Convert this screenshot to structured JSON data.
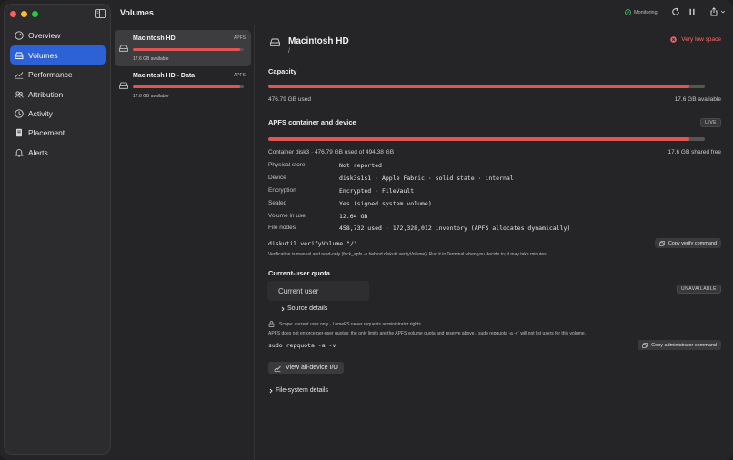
{
  "toolbar": {
    "title": "Volumes",
    "monitoring": "Monitoring"
  },
  "sidebar": {
    "items": [
      {
        "label": "Overview",
        "icon": "dashboard-icon"
      },
      {
        "label": "Volumes",
        "icon": "drive-icon"
      },
      {
        "label": "Performance",
        "icon": "chart-line-icon"
      },
      {
        "label": "Attribution",
        "icon": "people-icon"
      },
      {
        "label": "Activity",
        "icon": "clock-icon"
      },
      {
        "label": "Placement",
        "icon": "document-icon"
      },
      {
        "label": "Alerts",
        "icon": "bell-icon"
      }
    ],
    "active_index": 1
  },
  "volumes": [
    {
      "name": "Macintosh HD",
      "fs": "APFS",
      "available": "17.6 GB available",
      "used_fraction": 0.965
    },
    {
      "name": "Macintosh HD - Data",
      "fs": "APFS",
      "available": "17.6 GB available",
      "used_fraction": 0.965
    }
  ],
  "detail": {
    "name": "Macintosh HD",
    "mount": "/",
    "alert": "Very low space",
    "capacity": {
      "title": "Capacity",
      "used": "476.79 GB used",
      "available": "17.6 GB available",
      "used_fraction": 0.965
    },
    "container": {
      "title": "APFS container and device",
      "badge": "LIVE",
      "summary": "Container disk3 · 476.79 GB used of 494.38 GB",
      "shared_free": "17.6 GB shared free",
      "used_fraction": 0.965,
      "rows": [
        {
          "label": "Physical store",
          "value": "Not reported"
        },
        {
          "label": "Device",
          "value": "disk3s1s1 · Apple Fabric · solid state · internal"
        },
        {
          "label": "Encryption",
          "value": "Encrypted · FileVault"
        },
        {
          "label": "Sealed",
          "value": "Yes (signed system volume)"
        },
        {
          "label": "Volume in use",
          "value": "12.64 GB"
        },
        {
          "label": "File nodes",
          "value": "458,732 used · 172,328,012 inventory (APFS allocates dynamically)"
        }
      ],
      "verify_command": "diskutil verifyVolume \"/\"",
      "copy_verify_label": "Copy verify command",
      "verify_note": "Verification is manual and read-only (fsck_apfs -n behind diskutil verifyVolume). Run it in Terminal when you decide to; it may take minutes."
    },
    "quota": {
      "title": "Current-user quota",
      "badge": "UNAVAILABLE",
      "user_picker": "Current user",
      "source_details": "Source details",
      "scope_note": "Scope: current user only · LumeFS never requests administrator rights",
      "apfs_note": "APFS does not enforce per-user quotas; the only limits are the APFS volume quota and reserve above. `sudo repquota -a -v` will not list users for this volume.",
      "admin_command": "sudo repquota -a -v",
      "copy_admin_label": "Copy administrator command"
    },
    "io_button": "View all-device I/O",
    "fs_details": "File-system details"
  }
}
